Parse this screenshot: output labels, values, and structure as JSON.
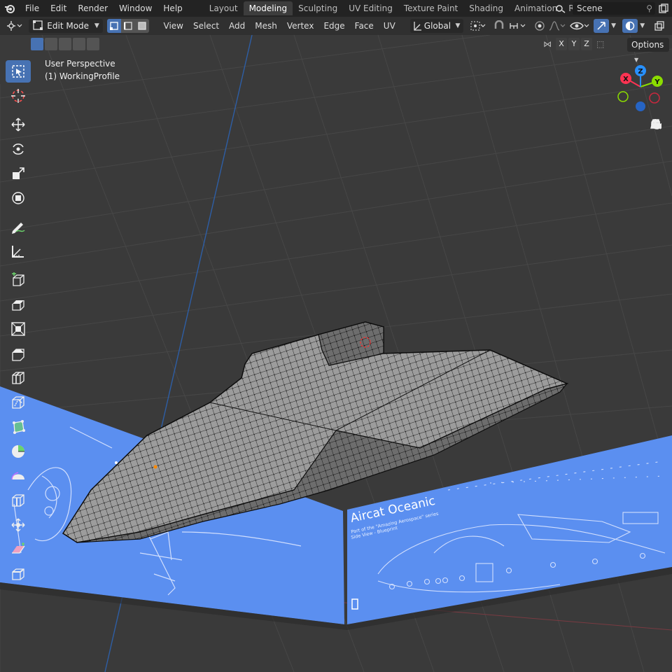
{
  "topbar": {
    "menus": [
      "File",
      "Edit",
      "Render",
      "Window",
      "Help"
    ],
    "workspaces": [
      "Layout",
      "Modeling",
      "Sculpting",
      "UV Editing",
      "Texture Paint",
      "Shading",
      "Animation",
      "Renderi"
    ],
    "active_workspace": "Modeling",
    "scene_name": "Scene"
  },
  "header": {
    "mode": "Edit Mode",
    "menus": [
      "View",
      "Select",
      "Add",
      "Mesh",
      "Vertex",
      "Edge",
      "Face",
      "UV"
    ],
    "orientation": "Global"
  },
  "subheader": {
    "axes": [
      "X",
      "Y",
      "Z"
    ],
    "options_label": "Options"
  },
  "viewport": {
    "view_name": "User Perspective",
    "object_name": "(1) WorkingProfile"
  },
  "gizmo": {
    "x_label": "X",
    "y_label": "Y",
    "z_label": "Z"
  },
  "blueprint": {
    "title": "Aircat Oceanic",
    "subtitle": "Part of the \"Amazing Aerospace\" series",
    "caption": "Side View - Blueprint"
  },
  "colors": {
    "accent": "#4772b3",
    "blueprint": "#5b8ff0",
    "axis_x": "#ff3352",
    "axis_y": "#8bdc00",
    "axis_z": "#2890ff"
  },
  "icons": {
    "toolbar": [
      "select-box-icon",
      "cursor-icon",
      "move-icon",
      "rotate-icon",
      "scale-icon",
      "transform-icon",
      "annotate-icon",
      "measure-icon",
      "add-cube-icon",
      "extrude-icon",
      "inset-icon",
      "bevel-icon",
      "loopcut-icon",
      "knife-icon",
      "polybuild-icon",
      "spin-icon",
      "smooth-icon",
      "edge-slide-icon",
      "shrink-fatten-icon",
      "shear-icon",
      "rip-icon"
    ]
  }
}
